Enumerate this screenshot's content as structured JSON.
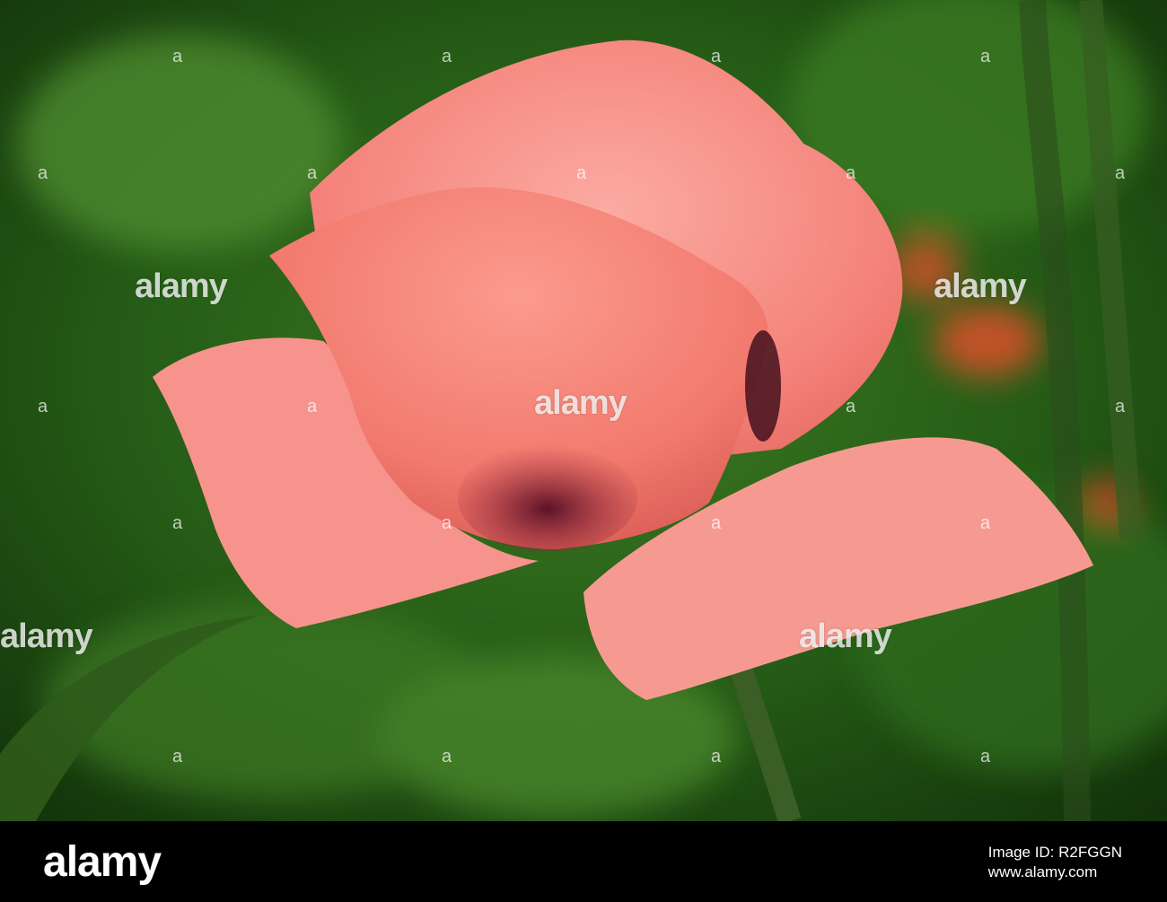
{
  "photo": {
    "subject": "pink poppy flower",
    "colors": {
      "background": "#1f4a12",
      "petal": "#f4827a",
      "petal_light": "#fbaba2",
      "center": "#5a1228",
      "stem": "#3b5d26"
    }
  },
  "watermark": {
    "brand": "alamy",
    "tile_text": "a"
  },
  "footer": {
    "logo": "alamy",
    "image_id_line": "Image ID: R2FGGN",
    "site": "www.alamy.com"
  }
}
